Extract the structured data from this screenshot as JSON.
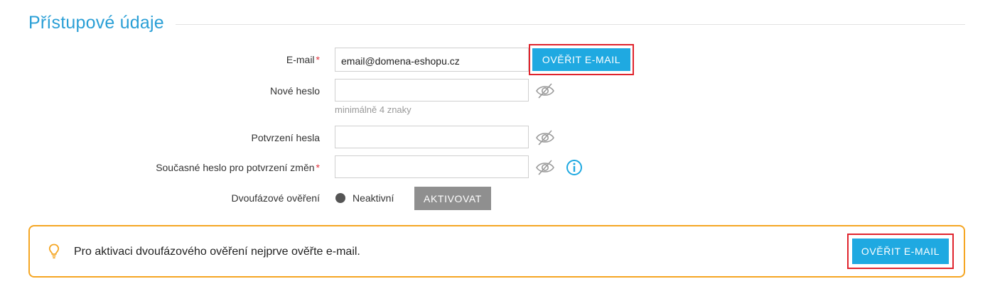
{
  "section": {
    "title": "Přístupové údaje"
  },
  "form": {
    "email": {
      "label": "E-mail",
      "required_mark": "*",
      "value": "email@domena-eshopu.cz",
      "verify_label": "Ověřit e-mail"
    },
    "new_password": {
      "label": "Nové heslo",
      "value": "",
      "hint": "minimálně 4 znaky"
    },
    "confirm_password": {
      "label": "Potvrzení hesla",
      "value": ""
    },
    "current_password": {
      "label": "Současné heslo pro potvrzení změn",
      "required_mark": "*",
      "value": ""
    },
    "two_factor": {
      "label": "Dvoufázové ověření",
      "status": "Neaktivní",
      "activate_label": "AKTIVOVAT"
    }
  },
  "alert": {
    "text": "Pro aktivaci dvoufázového ověření nejprve ověřte e-mail.",
    "verify_label": "Ověřit e-mail"
  },
  "colors": {
    "accent": "#1fa9e1",
    "title": "#2a9fd6",
    "required": "#e0303a",
    "alert_border": "#f5a623",
    "highlight": "#e0242d",
    "neutral_button": "#8f8f8f"
  },
  "icons": {
    "password_toggle": "eye-slash-icon",
    "info": "info-icon",
    "alert": "lightbulb-icon"
  }
}
